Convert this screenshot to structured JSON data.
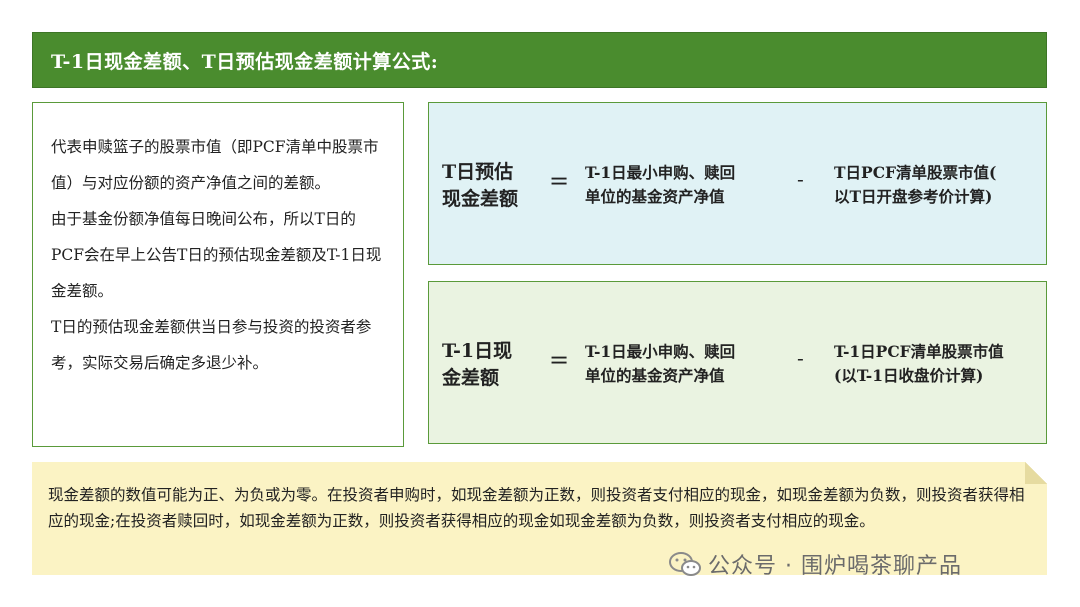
{
  "header": {
    "title": "T-1日现金差额、T日预估现金差额计算公式:"
  },
  "explanation": {
    "paragraphs": [
      "代表申赎篮子的股票市值（即PCF清单中股票市值）与对应份额的资产净值之间的差额。",
      "由于基金份额净值每日晚间公布，所以T日的PCF会在早上公告T日的预估现金差额及T-1日现金差额。",
      "T日的预估现金差额供当日参与投资的投资者参考，实际交易后确定多退少补。"
    ]
  },
  "formulas": [
    {
      "lhs_line1": "T日预估",
      "lhs_line2": "现金差额",
      "eq": "=",
      "term1_line1": "T-1日最小申购、赎回",
      "term1_line2": "单位的基金资产净值",
      "op": "-",
      "term2_line1": "T日PCF清单股票市值(",
      "term2_line2": "以T日开盘参考价计算)"
    },
    {
      "lhs_line1": "T-1日现",
      "lhs_line2": "金差额",
      "eq": "=",
      "term1_line1": "T-1日最小申购、赎回",
      "term1_line2": "单位的基金资产净值",
      "op": "-",
      "term2_line1": "T-1日PCF清单股票市值",
      "term2_line2": "(以T-1日收盘价计算)"
    }
  ],
  "note": {
    "text": "现金差额的数值可能为正、为负或为零。在投资者申购时，如现金差额为正数，则投资者支付相应的现金，如现金差额为负数，则投资者获得相应的现金;在投资者赎回时，如现金差额为正数，则投资者获得相应的现金如现金差额为负数，则投资者支付相应的现金。"
  },
  "watermark": {
    "icon": "wechat-icon",
    "text": "公众号 · 围炉喝茶聊产品"
  },
  "colors": {
    "title_bg": "#4a8c2e",
    "border": "#5a9a3a",
    "formula_t_bg": "#e0f2f5",
    "formula_t1_bg": "#eaf3e1",
    "note_bg": "#fbf3c4"
  }
}
